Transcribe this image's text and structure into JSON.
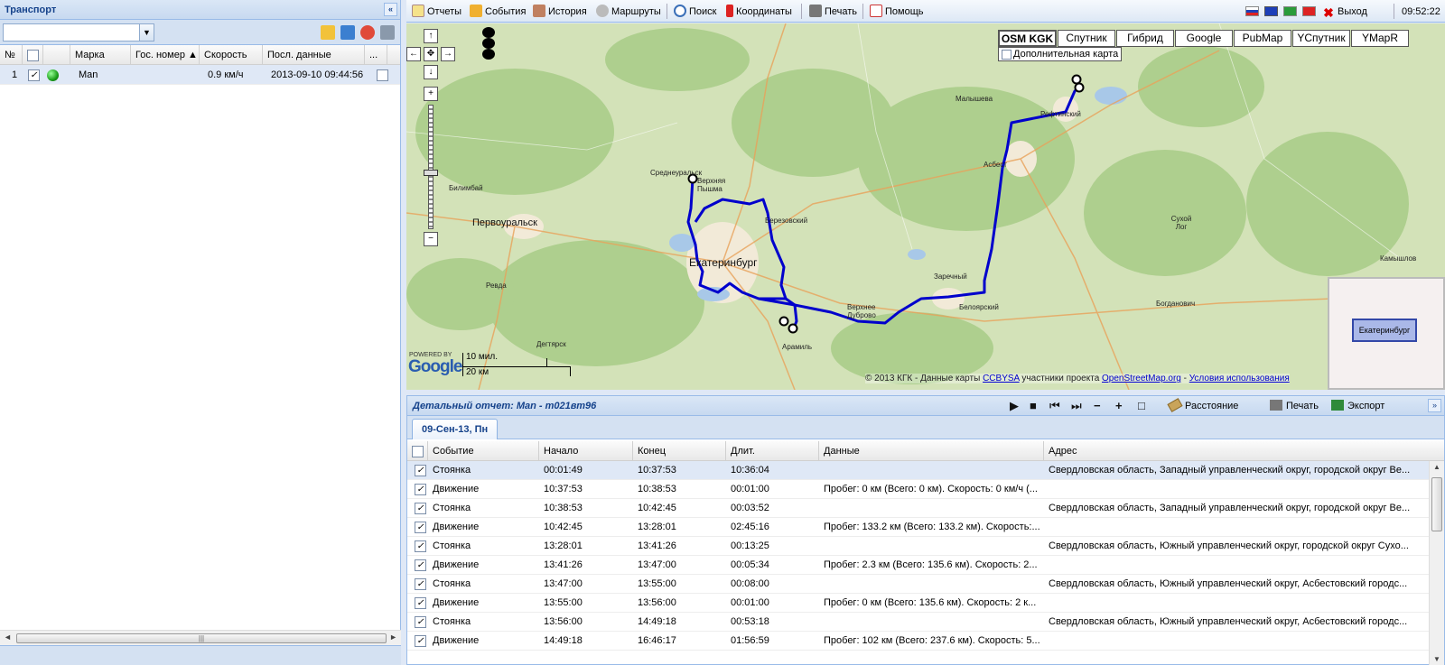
{
  "left_panel": {
    "title": "Транспорт",
    "collapse": "«",
    "grid_headers": [
      "№",
      "",
      "",
      "Марка",
      "Гос. номер ▲",
      "Скорость",
      "Посл. данные",
      "..."
    ],
    "rows": [
      {
        "num": "1",
        "checked": "✓",
        "brand": "Man",
        "plate": "",
        "speed": "0.9 км/ч",
        "last": "2013-09-10 09:44:56"
      }
    ],
    "scroll_grip": "|||"
  },
  "menu": {
    "items": [
      "Отчеты",
      "События",
      "История",
      "Маршруты",
      "Поиск",
      "Координаты",
      "Печать",
      "Помощь"
    ],
    "exit": "Выход",
    "time": "09:52:22"
  },
  "map": {
    "type_buttons": [
      "OSM KGK",
      "Спутник",
      "Гибрид",
      "Google",
      "PubMap",
      "YСпутник",
      "YMapR"
    ],
    "extra_map": "Дополнительная карта",
    "places": [
      {
        "name": "Первоуральск",
        "cls": "big"
      },
      {
        "name": "Екатеринбург",
        "cls": "city"
      },
      {
        "name": "Среднеуральск",
        "cls": ""
      },
      {
        "name": "Верхняя Пышма",
        "cls": ""
      },
      {
        "name": "Березовский",
        "cls": ""
      },
      {
        "name": "Билимбай",
        "cls": ""
      },
      {
        "name": "Ревда",
        "cls": ""
      },
      {
        "name": "Арамиль",
        "cls": ""
      },
      {
        "name": "Верхнее Дуброво",
        "cls": ""
      },
      {
        "name": "Белоярский",
        "cls": ""
      },
      {
        "name": "Заречный",
        "cls": ""
      },
      {
        "name": "Асбест",
        "cls": ""
      },
      {
        "name": "Малышева",
        "cls": ""
      },
      {
        "name": "Рефтинский",
        "cls": ""
      },
      {
        "name": "Сухой Лог",
        "cls": ""
      },
      {
        "name": "Богданович",
        "cls": ""
      },
      {
        "name": "Камышлов",
        "cls": ""
      },
      {
        "name": "Дегтярск",
        "cls": ""
      }
    ],
    "scale": {
      "miles": "10 мил.",
      "km": "20 км"
    },
    "powered": "POWERED BY",
    "google": "Google",
    "attribution": {
      "prefix": "© 2013 КГК - Данные карты ",
      "ccbysa": "CCBYSA",
      "middle": " участники проекта ",
      "osm": "OpenStreetMap.org",
      "dash": " - ",
      "terms": "Условия использования"
    },
    "minimap_label": "Екатеринбург",
    "route_color": "#0000cc"
  },
  "report": {
    "title": "Детальный отчет: Man - т021вт96",
    "distance": "Расстояние",
    "print": "Печать",
    "export": "Экспорт",
    "tab": "09-Сен-13, Пн",
    "headers": [
      "",
      "Событие",
      "Начало",
      "Конец",
      "Длит.",
      "Данные",
      "Адрес"
    ],
    "rows": [
      {
        "event": "Стоянка",
        "start": "00:01:49",
        "end": "10:37:53",
        "dur": "10:36:04",
        "data": "",
        "addr": "Свердловская область, Западный управленческий округ, городской округ Ве..."
      },
      {
        "event": "Движение",
        "start": "10:37:53",
        "end": "10:38:53",
        "dur": "00:01:00",
        "data": "Пробег: 0 км (Всего: 0 км). Скорость: 0 км/ч (...",
        "addr": ""
      },
      {
        "event": "Стоянка",
        "start": "10:38:53",
        "end": "10:42:45",
        "dur": "00:03:52",
        "data": "",
        "addr": "Свердловская область, Западный управленческий округ, городской округ Ве..."
      },
      {
        "event": "Движение",
        "start": "10:42:45",
        "end": "13:28:01",
        "dur": "02:45:16",
        "data": "Пробег: 133.2 км (Всего: 133.2 км). Скорость:...",
        "addr": ""
      },
      {
        "event": "Стоянка",
        "start": "13:28:01",
        "end": "13:41:26",
        "dur": "00:13:25",
        "data": "",
        "addr": "Свердловская область, Южный управленческий округ, городской округ Сухо..."
      },
      {
        "event": "Движение",
        "start": "13:41:26",
        "end": "13:47:00",
        "dur": "00:05:34",
        "data": "Пробег: 2.3 км (Всего: 135.6 км). Скорость: 2...",
        "addr": ""
      },
      {
        "event": "Стоянка",
        "start": "13:47:00",
        "end": "13:55:00",
        "dur": "00:08:00",
        "data": "",
        "addr": "Свердловская область, Южный управленческий округ, Асбестовский городс..."
      },
      {
        "event": "Движение",
        "start": "13:55:00",
        "end": "13:56:00",
        "dur": "00:01:00",
        "data": "Пробег: 0 км (Всего: 135.6 км). Скорость: 2 к...",
        "addr": ""
      },
      {
        "event": "Стоянка",
        "start": "13:56:00",
        "end": "14:49:18",
        "dur": "00:53:18",
        "data": "",
        "addr": "Свердловская область, Южный управленческий округ, Асбестовский городс..."
      },
      {
        "event": "Движение",
        "start": "14:49:18",
        "end": "16:46:17",
        "dur": "01:56:59",
        "data": "Пробег: 102 км (Всего: 237.6 км). Скорость: 5...",
        "addr": ""
      }
    ]
  }
}
